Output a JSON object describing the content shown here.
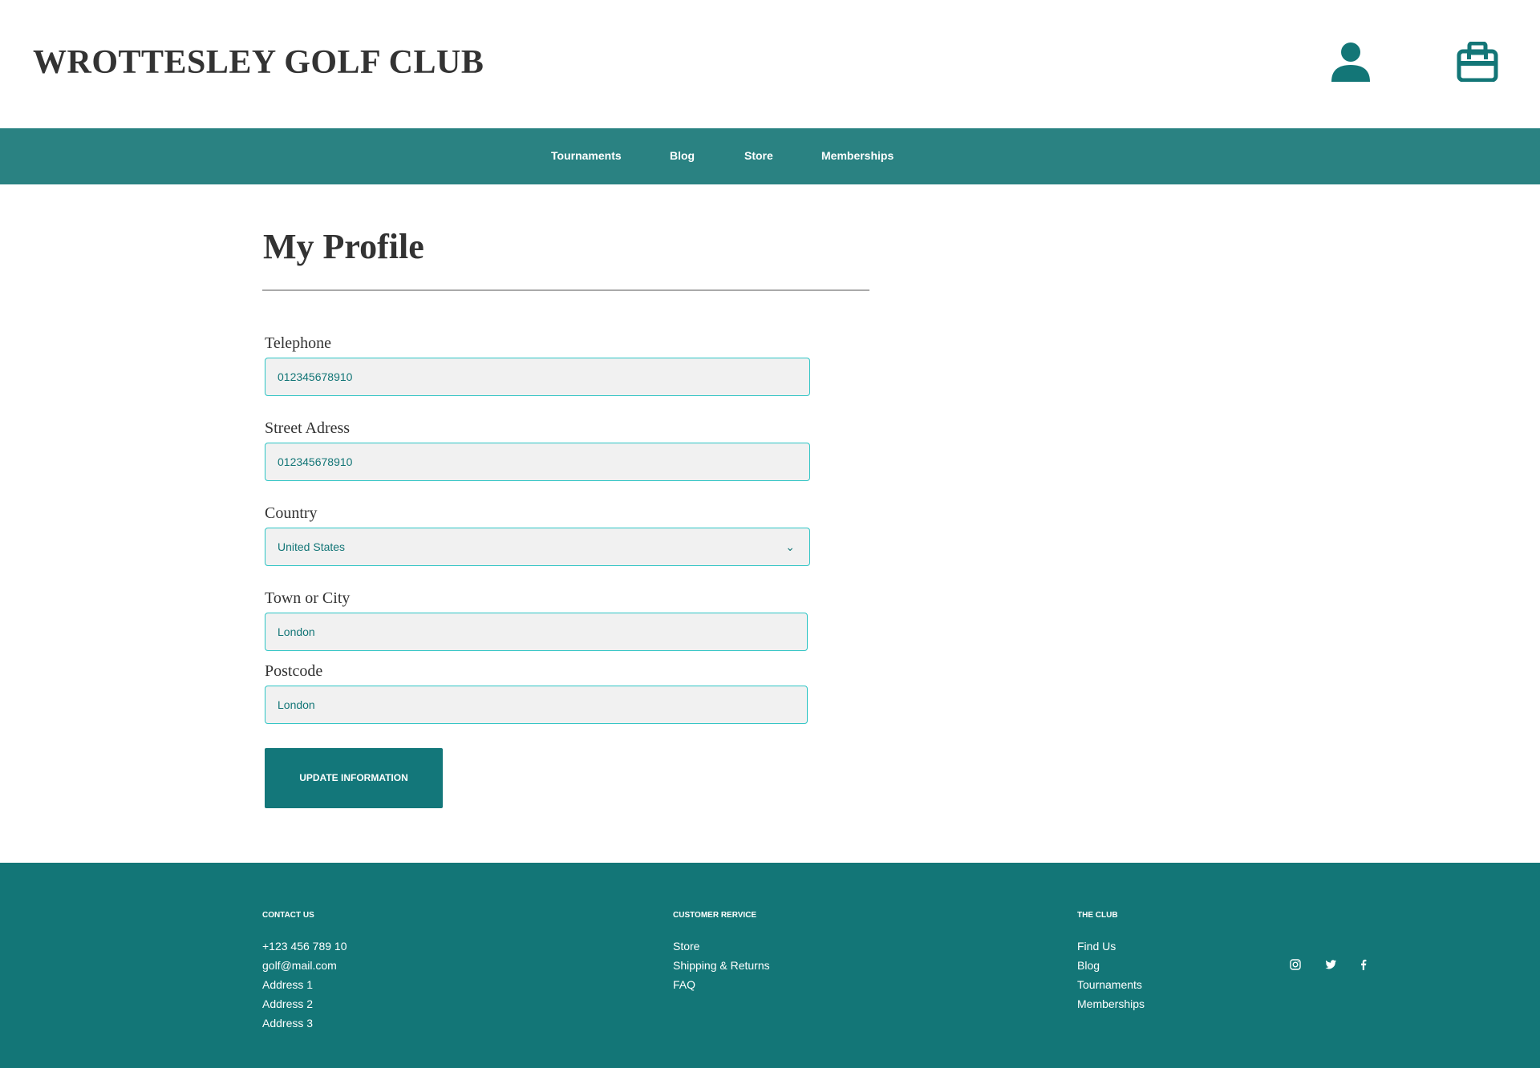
{
  "header": {
    "title": "WROTTESLEY GOLF CLUB",
    "icons": [
      "user-icon",
      "briefcase-icon"
    ]
  },
  "nav": [
    "Tournaments",
    "Blog",
    "Store",
    "Memberships"
  ],
  "page": {
    "title": "My Profile"
  },
  "form": {
    "telephone": {
      "label": "Telephone",
      "value": "012345678910"
    },
    "street": {
      "label": "Street Adress",
      "value": "012345678910"
    },
    "country": {
      "label": "Country",
      "value": "United States"
    },
    "town": {
      "label": "Town or City",
      "value": "London"
    },
    "postcode": {
      "label": "Postcode",
      "value": "London"
    },
    "submit": "UPDATE INFORMATION"
  },
  "footer": {
    "contact": {
      "heading": "CONTACT US",
      "items": [
        "+123 456 789 10",
        "golf@mail.com",
        "Address 1",
        "Address 2",
        "Address 3"
      ]
    },
    "service": {
      "heading": "CUSTOMER RERVICE",
      "items": [
        "Store",
        "Shipping & Returns",
        "FAQ"
      ]
    },
    "club": {
      "heading": "THE CLUB",
      "items": [
        "Find Us",
        "Blog",
        "Tournaments",
        "Memberships"
      ]
    },
    "social": [
      "instagram-icon",
      "twitter-icon",
      "facebook-icon"
    ]
  },
  "colors": {
    "nav": "#2a8282",
    "footer": "#137677",
    "accent": "#2cc4c4"
  }
}
